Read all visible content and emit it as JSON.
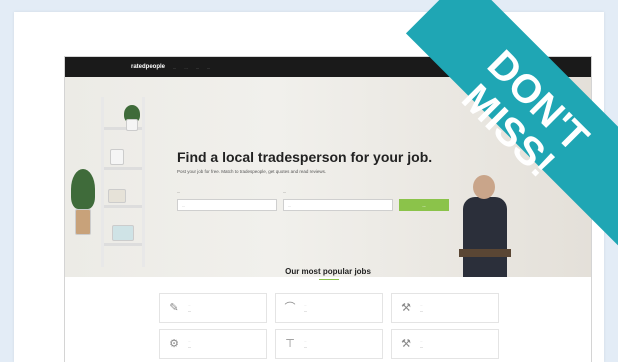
{
  "site": {
    "logo": "ratedpeople",
    "nav": [
      "...",
      "...",
      "...",
      "..."
    ]
  },
  "hero": {
    "title": "Find a local tradesperson for your job.",
    "subtitle": "Post your job for free. Match to tradespeople, get quotes and read reviews.",
    "job_label": "...",
    "postcode_label": "...",
    "job_placeholder": "...",
    "postcode_placeholder": "...",
    "button": "..."
  },
  "popular": {
    "title": "Our most popular jobs",
    "jobs": [
      {
        "category": "...",
        "title": "...",
        "icon": "brush-icon"
      },
      {
        "category": "...",
        "title": "...",
        "icon": "pipe-icon"
      },
      {
        "category": "...",
        "title": "...",
        "icon": "hammer-icon"
      },
      {
        "category": "...",
        "title": "...",
        "icon": "gear-icon"
      },
      {
        "category": "...",
        "title": "...",
        "icon": "plumbing-icon"
      },
      {
        "category": "...",
        "title": "...",
        "icon": "tools-icon"
      }
    ]
  },
  "banner": {
    "line1": "DON'T",
    "line2": "MISS!",
    "color": "#1fa6b4"
  },
  "colors": {
    "accent": "#8bc34a",
    "navbar": "#1a1a1a",
    "background": "#e3ecf6"
  }
}
